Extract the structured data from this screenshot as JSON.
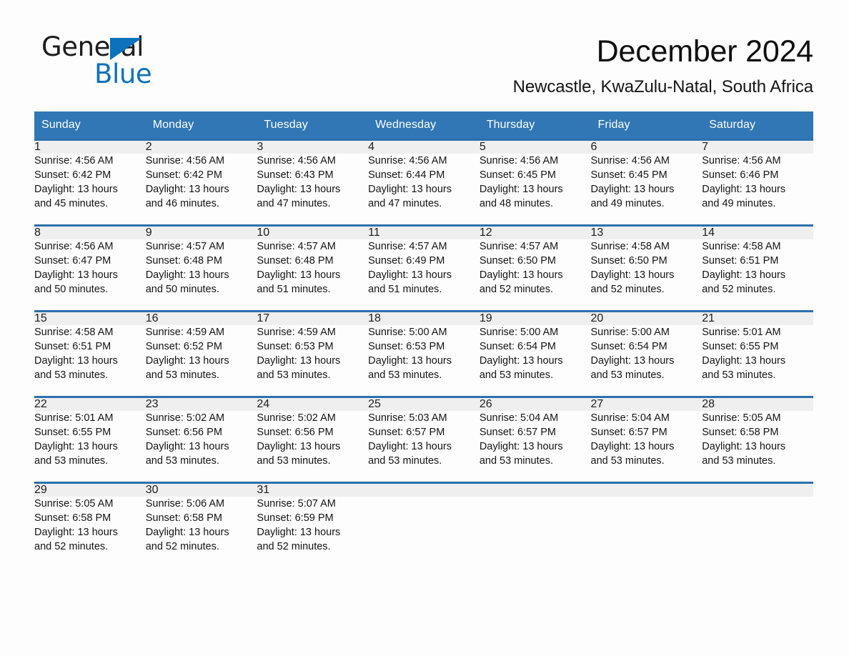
{
  "brand": {
    "name_part1": "General",
    "name_part2": "Blue",
    "accent_color": "#0b72bb"
  },
  "header": {
    "title": "December 2024",
    "location": "Newcastle, KwaZulu-Natal, South Africa"
  },
  "calendar": {
    "header_color": "#3177b5",
    "rule_color": "#2c6fad",
    "daynum_band_color": "#efefef",
    "weekday_headers": [
      "Sunday",
      "Monday",
      "Tuesday",
      "Wednesday",
      "Thursday",
      "Friday",
      "Saturday"
    ],
    "weeks": [
      [
        {
          "date": "1",
          "sunrise": "Sunrise: 4:56 AM",
          "sunset": "Sunset: 6:42 PM",
          "daylight_line1": "Daylight: 13 hours",
          "daylight_line2": "and 45 minutes."
        },
        {
          "date": "2",
          "sunrise": "Sunrise: 4:56 AM",
          "sunset": "Sunset: 6:42 PM",
          "daylight_line1": "Daylight: 13 hours",
          "daylight_line2": "and 46 minutes."
        },
        {
          "date": "3",
          "sunrise": "Sunrise: 4:56 AM",
          "sunset": "Sunset: 6:43 PM",
          "daylight_line1": "Daylight: 13 hours",
          "daylight_line2": "and 47 minutes."
        },
        {
          "date": "4",
          "sunrise": "Sunrise: 4:56 AM",
          "sunset": "Sunset: 6:44 PM",
          "daylight_line1": "Daylight: 13 hours",
          "daylight_line2": "and 47 minutes."
        },
        {
          "date": "5",
          "sunrise": "Sunrise: 4:56 AM",
          "sunset": "Sunset: 6:45 PM",
          "daylight_line1": "Daylight: 13 hours",
          "daylight_line2": "and 48 minutes."
        },
        {
          "date": "6",
          "sunrise": "Sunrise: 4:56 AM",
          "sunset": "Sunset: 6:45 PM",
          "daylight_line1": "Daylight: 13 hours",
          "daylight_line2": "and 49 minutes."
        },
        {
          "date": "7",
          "sunrise": "Sunrise: 4:56 AM",
          "sunset": "Sunset: 6:46 PM",
          "daylight_line1": "Daylight: 13 hours",
          "daylight_line2": "and 49 minutes."
        }
      ],
      [
        {
          "date": "8",
          "sunrise": "Sunrise: 4:56 AM",
          "sunset": "Sunset: 6:47 PM",
          "daylight_line1": "Daylight: 13 hours",
          "daylight_line2": "and 50 minutes."
        },
        {
          "date": "9",
          "sunrise": "Sunrise: 4:57 AM",
          "sunset": "Sunset: 6:48 PM",
          "daylight_line1": "Daylight: 13 hours",
          "daylight_line2": "and 50 minutes."
        },
        {
          "date": "10",
          "sunrise": "Sunrise: 4:57 AM",
          "sunset": "Sunset: 6:48 PM",
          "daylight_line1": "Daylight: 13 hours",
          "daylight_line2": "and 51 minutes."
        },
        {
          "date": "11",
          "sunrise": "Sunrise: 4:57 AM",
          "sunset": "Sunset: 6:49 PM",
          "daylight_line1": "Daylight: 13 hours",
          "daylight_line2": "and 51 minutes."
        },
        {
          "date": "12",
          "sunrise": "Sunrise: 4:57 AM",
          "sunset": "Sunset: 6:50 PM",
          "daylight_line1": "Daylight: 13 hours",
          "daylight_line2": "and 52 minutes."
        },
        {
          "date": "13",
          "sunrise": "Sunrise: 4:58 AM",
          "sunset": "Sunset: 6:50 PM",
          "daylight_line1": "Daylight: 13 hours",
          "daylight_line2": "and 52 minutes."
        },
        {
          "date": "14",
          "sunrise": "Sunrise: 4:58 AM",
          "sunset": "Sunset: 6:51 PM",
          "daylight_line1": "Daylight: 13 hours",
          "daylight_line2": "and 52 minutes."
        }
      ],
      [
        {
          "date": "15",
          "sunrise": "Sunrise: 4:58 AM",
          "sunset": "Sunset: 6:51 PM",
          "daylight_line1": "Daylight: 13 hours",
          "daylight_line2": "and 53 minutes."
        },
        {
          "date": "16",
          "sunrise": "Sunrise: 4:59 AM",
          "sunset": "Sunset: 6:52 PM",
          "daylight_line1": "Daylight: 13 hours",
          "daylight_line2": "and 53 minutes."
        },
        {
          "date": "17",
          "sunrise": "Sunrise: 4:59 AM",
          "sunset": "Sunset: 6:53 PM",
          "daylight_line1": "Daylight: 13 hours",
          "daylight_line2": "and 53 minutes."
        },
        {
          "date": "18",
          "sunrise": "Sunrise: 5:00 AM",
          "sunset": "Sunset: 6:53 PM",
          "daylight_line1": "Daylight: 13 hours",
          "daylight_line2": "and 53 minutes."
        },
        {
          "date": "19",
          "sunrise": "Sunrise: 5:00 AM",
          "sunset": "Sunset: 6:54 PM",
          "daylight_line1": "Daylight: 13 hours",
          "daylight_line2": "and 53 minutes."
        },
        {
          "date": "20",
          "sunrise": "Sunrise: 5:00 AM",
          "sunset": "Sunset: 6:54 PM",
          "daylight_line1": "Daylight: 13 hours",
          "daylight_line2": "and 53 minutes."
        },
        {
          "date": "21",
          "sunrise": "Sunrise: 5:01 AM",
          "sunset": "Sunset: 6:55 PM",
          "daylight_line1": "Daylight: 13 hours",
          "daylight_line2": "and 53 minutes."
        }
      ],
      [
        {
          "date": "22",
          "sunrise": "Sunrise: 5:01 AM",
          "sunset": "Sunset: 6:55 PM",
          "daylight_line1": "Daylight: 13 hours",
          "daylight_line2": "and 53 minutes."
        },
        {
          "date": "23",
          "sunrise": "Sunrise: 5:02 AM",
          "sunset": "Sunset: 6:56 PM",
          "daylight_line1": "Daylight: 13 hours",
          "daylight_line2": "and 53 minutes."
        },
        {
          "date": "24",
          "sunrise": "Sunrise: 5:02 AM",
          "sunset": "Sunset: 6:56 PM",
          "daylight_line1": "Daylight: 13 hours",
          "daylight_line2": "and 53 minutes."
        },
        {
          "date": "25",
          "sunrise": "Sunrise: 5:03 AM",
          "sunset": "Sunset: 6:57 PM",
          "daylight_line1": "Daylight: 13 hours",
          "daylight_line2": "and 53 minutes."
        },
        {
          "date": "26",
          "sunrise": "Sunrise: 5:04 AM",
          "sunset": "Sunset: 6:57 PM",
          "daylight_line1": "Daylight: 13 hours",
          "daylight_line2": "and 53 minutes."
        },
        {
          "date": "27",
          "sunrise": "Sunrise: 5:04 AM",
          "sunset": "Sunset: 6:57 PM",
          "daylight_line1": "Daylight: 13 hours",
          "daylight_line2": "and 53 minutes."
        },
        {
          "date": "28",
          "sunrise": "Sunrise: 5:05 AM",
          "sunset": "Sunset: 6:58 PM",
          "daylight_line1": "Daylight: 13 hours",
          "daylight_line2": "and 53 minutes."
        }
      ],
      [
        {
          "date": "29",
          "sunrise": "Sunrise: 5:05 AM",
          "sunset": "Sunset: 6:58 PM",
          "daylight_line1": "Daylight: 13 hours",
          "daylight_line2": "and 52 minutes."
        },
        {
          "date": "30",
          "sunrise": "Sunrise: 5:06 AM",
          "sunset": "Sunset: 6:58 PM",
          "daylight_line1": "Daylight: 13 hours",
          "daylight_line2": "and 52 minutes."
        },
        {
          "date": "31",
          "sunrise": "Sunrise: 5:07 AM",
          "sunset": "Sunset: 6:59 PM",
          "daylight_line1": "Daylight: 13 hours",
          "daylight_line2": "and 52 minutes."
        },
        {
          "date": "",
          "sunrise": "",
          "sunset": "",
          "daylight_line1": "",
          "daylight_line2": ""
        },
        {
          "date": "",
          "sunrise": "",
          "sunset": "",
          "daylight_line1": "",
          "daylight_line2": ""
        },
        {
          "date": "",
          "sunrise": "",
          "sunset": "",
          "daylight_line1": "",
          "daylight_line2": ""
        },
        {
          "date": "",
          "sunrise": "",
          "sunset": "",
          "daylight_line1": "",
          "daylight_line2": ""
        }
      ]
    ]
  }
}
